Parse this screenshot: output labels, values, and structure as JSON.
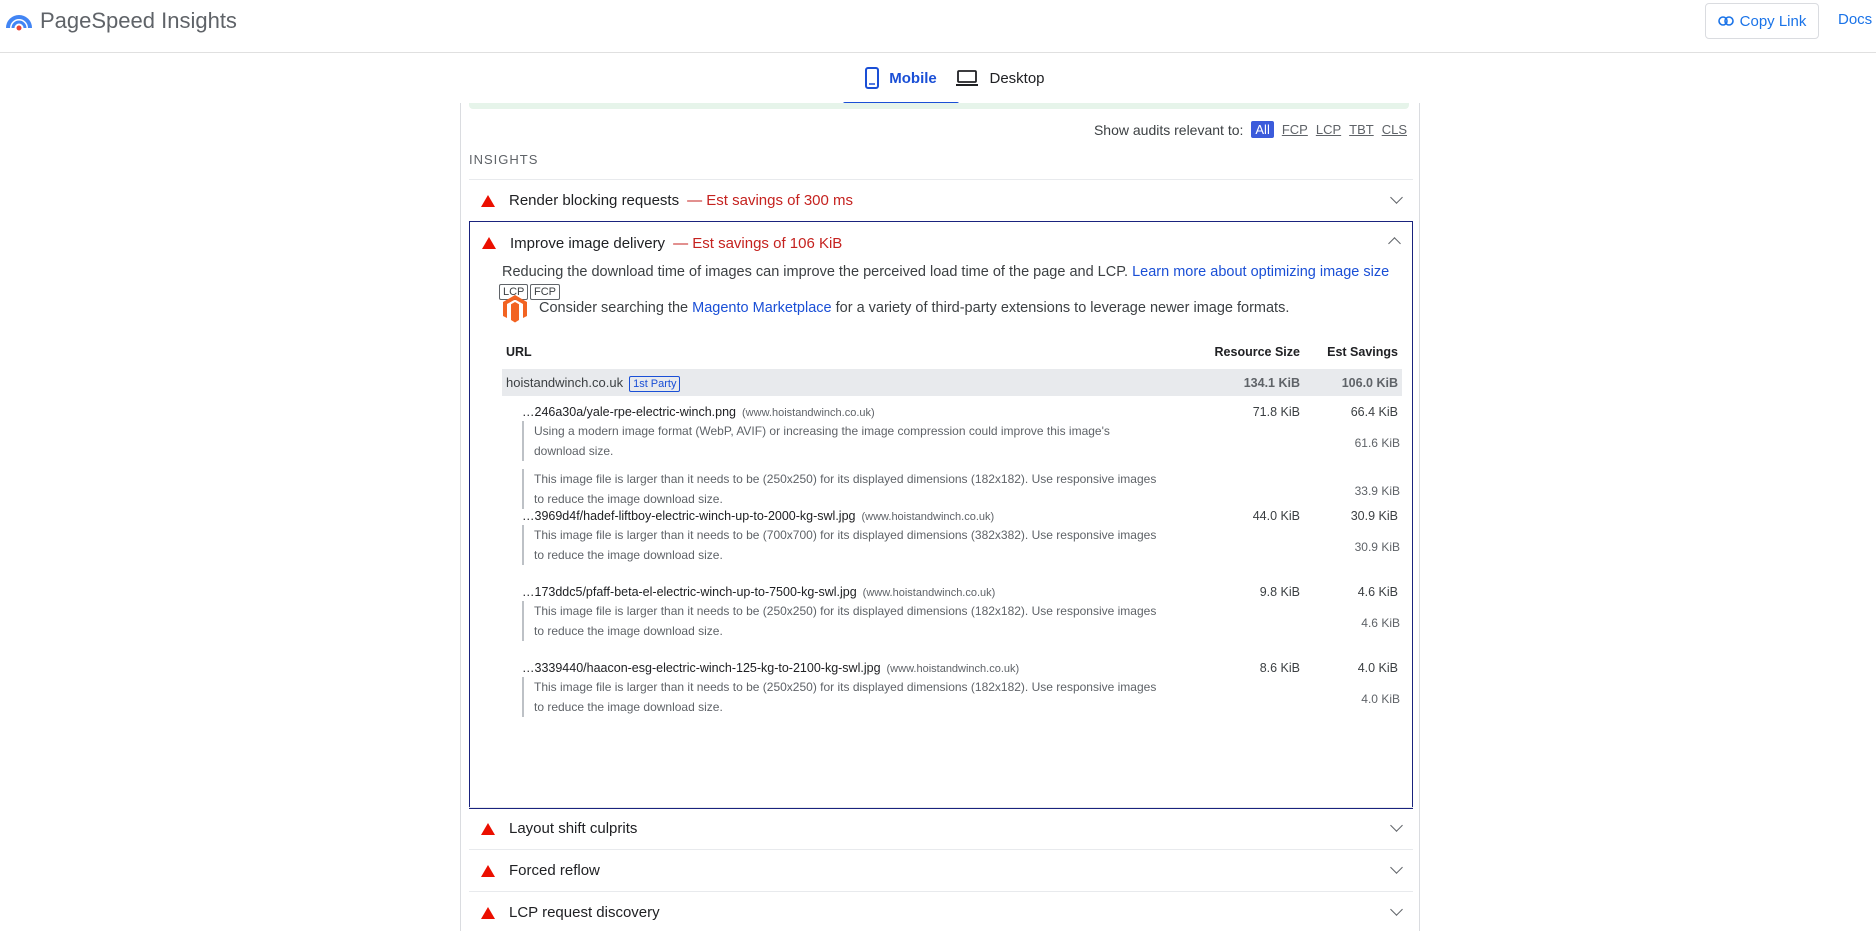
{
  "header": {
    "brand": "PageSpeed Insights",
    "copy_link": "Copy Link",
    "docs": "Docs"
  },
  "tabs": [
    {
      "label": "Mobile",
      "selected": true
    },
    {
      "label": "Desktop",
      "selected": false
    }
  ],
  "filter": {
    "label": "Show audits relevant to:",
    "options": [
      "All",
      "FCP",
      "LCP",
      "TBT",
      "CLS"
    ],
    "selected": "All"
  },
  "section_title": "INSIGHTS",
  "audits": {
    "render_blocking": {
      "title": "Render blocking requests",
      "savings": "— Est savings of 300 ms"
    },
    "image_delivery": {
      "title": "Improve image delivery",
      "savings": "— Est savings of 106 KiB"
    },
    "layout_shift": {
      "title": "Layout shift culprits"
    },
    "forced_reflow": {
      "title": "Forced reflow"
    },
    "lcp_discovery": {
      "title": "LCP request discovery"
    }
  },
  "detail": {
    "description": "Reducing the download time of images can improve the perceived load time of the page and LCP.",
    "learn_more": "Learn more about optimizing image size",
    "chips": [
      "LCP",
      "FCP"
    ],
    "consider_pre": "Consider searching the",
    "consider_link": "Magento Marketplace",
    "consider_post": "for a variety of third-party extensions to leverage newer image formats.",
    "columns": {
      "url": "URL",
      "size": "Resource Size",
      "savings": "Est Savings"
    },
    "group": {
      "host": "hoistandwinch.co.uk",
      "badge": "1st Party",
      "size": "134.1 KiB",
      "savings": "106.0 KiB"
    },
    "items": [
      {
        "url": "…246a30a/yale-rpe-electric-winch.png",
        "host": "(www.hoistandwinch.co.uk)",
        "size": "71.8 KiB",
        "savings": "66.4 KiB",
        "subs": [
          {
            "text": "Using a modern image format (WebP, AVIF) or increasing the image compression could improve this image's download size.",
            "savings": "61.6 KiB"
          },
          {
            "text": "This image file is larger than it needs to be (250x250) for its displayed dimensions (182x182). Use responsive images to reduce the image download size.",
            "savings": "33.9 KiB"
          }
        ]
      },
      {
        "url": "…3969d4f/hadef-liftboy-electric-winch-up-to-2000-kg-swl.jpg",
        "host": "(www.hoistandwinch.co.uk)",
        "size": "44.0 KiB",
        "savings": "30.9 KiB",
        "subs": [
          {
            "text": "This image file is larger than it needs to be (700x700) for its displayed dimensions (382x382). Use responsive images to reduce the image download size.",
            "savings": "30.9 KiB"
          }
        ]
      },
      {
        "url": "…173ddc5/pfaff-beta-el-electric-winch-up-to-7500-kg-swl.jpg",
        "host": "(www.hoistandwinch.co.uk)",
        "size": "9.8 KiB",
        "savings": "4.6 KiB",
        "subs": [
          {
            "text": "This image file is larger than it needs to be (250x250) for its displayed dimensions (182x182). Use responsive images to reduce the image download size.",
            "savings": "4.6 KiB"
          }
        ]
      },
      {
        "url": "…3339440/haacon-esg-electric-winch-125-kg-to-2100-kg-swl.jpg",
        "host": "(www.hoistandwinch.co.uk)",
        "size": "8.6 KiB",
        "savings": "4.0 KiB",
        "subs": [
          {
            "text": "This image file is larger than it needs to be (250x250) for its displayed dimensions (182x182). Use responsive images to reduce the image download size.",
            "savings": "4.0 KiB"
          }
        ]
      }
    ]
  },
  "colors": {
    "accent": "#1a4fd6",
    "fail": "#eb0f00",
    "savings": "#c5221f"
  }
}
